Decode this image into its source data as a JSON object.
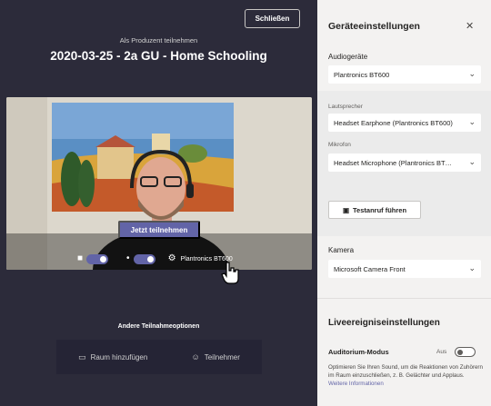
{
  "lobby": {
    "close_label": "Schließen",
    "producer_label": "Als Produzent teilnehmen",
    "meeting_title": "2020-03-25 - 2a GU - Home Schooling",
    "join_label": "Jetzt teilnehmen",
    "device_label": "Plantronics BT600",
    "camera_on": true,
    "mic_on": true,
    "other_options_label": "Andere Teilnahmeoptionen",
    "add_room_label": "Raum hinzufügen",
    "participants_label": "Teilnehmer"
  },
  "settings": {
    "title": "Geräteeinstellungen",
    "audio_devices_label": "Audiogeräte",
    "audio_device_value": "Plantronics BT600",
    "speaker_label": "Lautsprecher",
    "speaker_value": "Headset Earphone (Plantronics BT600)",
    "mic_label": "Mikrofon",
    "mic_value": "Headset Microphone (Plantronics BT…",
    "test_call_label": "Testanruf führen",
    "camera_label": "Kamera",
    "camera_value": "Microsoft Camera Front",
    "live_title": "Liveereigniseinstellungen",
    "auditorium_label": "Auditorium-Modus",
    "auditorium_state": "Aus",
    "auditorium_on": false,
    "description": "Optimieren Sie Ihren Sound, um die Reaktionen von Zuhörern im Raum einzuschließen, z. B. Gelächter und Applaus.",
    "more_info_link": "Weitere Informationen"
  },
  "colors": {
    "left_bg": "#2c2b3a",
    "accent": "#6264a7",
    "panel_bg": "#f3f2f1"
  }
}
